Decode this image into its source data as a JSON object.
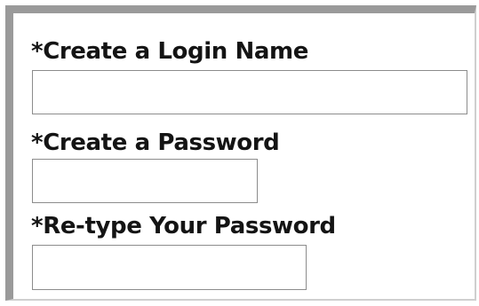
{
  "form": {
    "login_name": {
      "label": "*Create a Login Name",
      "value": "",
      "placeholder": ""
    },
    "password": {
      "label": "*Create a Password",
      "value": "",
      "placeholder": ""
    },
    "retype_password": {
      "label": "*Re-type Your Password",
      "value": "",
      "placeholder": ""
    }
  }
}
